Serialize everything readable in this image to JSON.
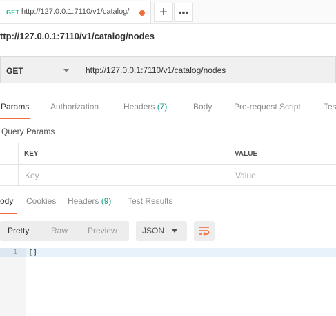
{
  "tab": {
    "method": "GET",
    "url": "http://127.0.0.1:7110/v1/catalog/",
    "add_label": "+",
    "more_label": "•••"
  },
  "request": {
    "title": "ttp://127.0.0.1:7110/v1/catalog/nodes",
    "method": "GET",
    "url": "http://127.0.0.1:7110/v1/catalog/nodes"
  },
  "request_tabs": [
    {
      "label": "Params"
    },
    {
      "label": "Authorization"
    },
    {
      "label": "Headers",
      "count": "(7)"
    },
    {
      "label": "Body"
    },
    {
      "label": "Pre-request Script"
    },
    {
      "label": "Tes"
    }
  ],
  "query_params": {
    "title": "Query Params",
    "key_header": "KEY",
    "value_header": "VALUE",
    "key_placeholder": "Key",
    "value_placeholder": "Value"
  },
  "response_tabs": [
    {
      "label": "ody"
    },
    {
      "label": "Cookies"
    },
    {
      "label": "Headers",
      "count": "(9)"
    },
    {
      "label": "Test Results"
    }
  ],
  "view": {
    "pretty": "Pretty",
    "raw": "Raw",
    "preview": "Preview",
    "format": "JSON"
  },
  "editor": {
    "line_number": "1",
    "content": "[]"
  },
  "colors": {
    "accent": "#f26b3a",
    "method_green": "#0cb08a",
    "count_green": "#16a085"
  }
}
